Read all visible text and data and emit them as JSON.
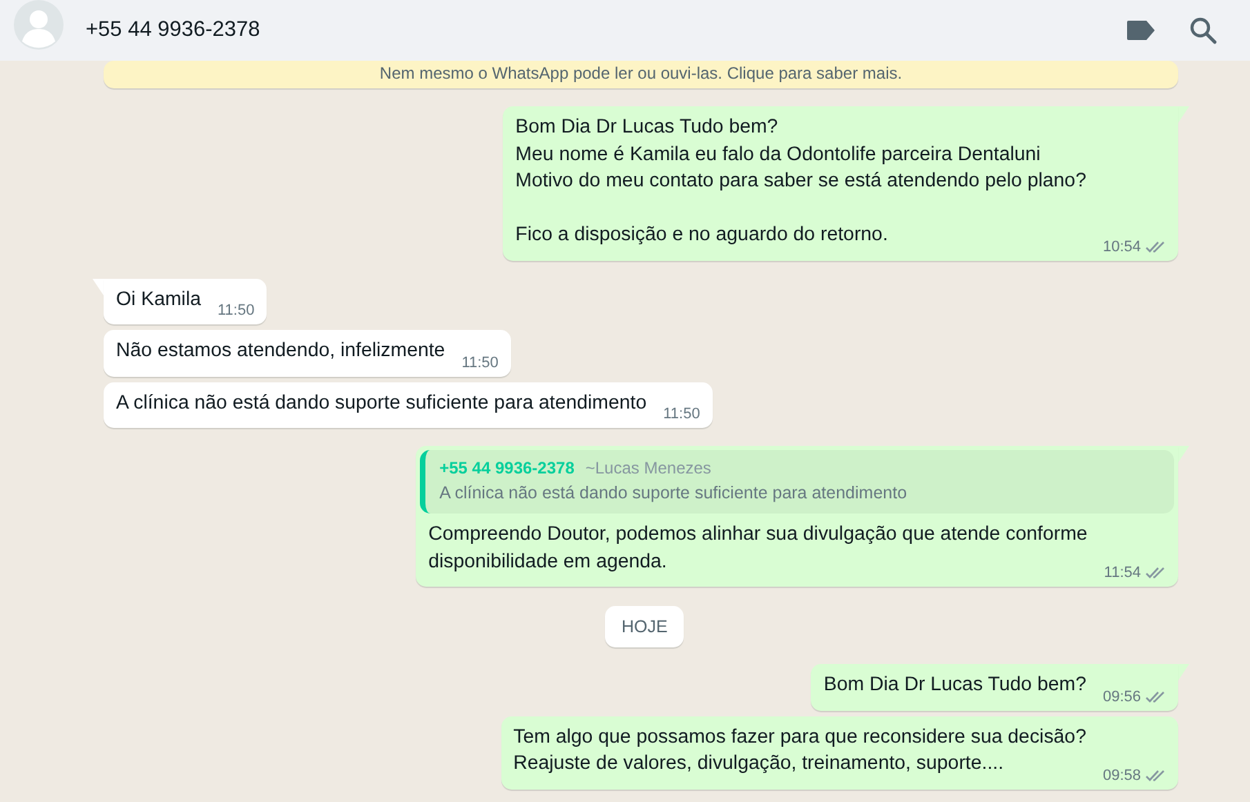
{
  "header": {
    "contact": "+55 44 9936-2378"
  },
  "encryption_notice": "Nem mesmo o WhatsApp pode ler ou ouvi-las. Clique para saber mais.",
  "items": [
    {
      "kind": "message",
      "outgoing": true,
      "tail": true,
      "text": "Bom Dia Dr Lucas Tudo bem?\nMeu nome é Kamila eu falo da Odontolife parceira Dentaluni\nMotivo do meu contato para saber se está atendendo pelo plano?\n\nFico a disposição e no aguardo do retorno.",
      "time": "10:54",
      "read": false
    },
    {
      "kind": "message",
      "outgoing": false,
      "tail": true,
      "text": "Oi Kamila",
      "time": "11:50"
    },
    {
      "kind": "message",
      "outgoing": false,
      "tail": false,
      "text": "Não estamos atendendo, infelizmente",
      "time": "11:50"
    },
    {
      "kind": "message",
      "outgoing": false,
      "tail": false,
      "text": "A clínica não está dando suporte suficiente para atendimento",
      "time": "11:50"
    },
    {
      "kind": "message",
      "outgoing": true,
      "tail": true,
      "quote": {
        "sender": "+55 44 9936-2378",
        "author": "~Lucas Menezes",
        "text": "A clínica não está dando suporte suficiente para atendimento"
      },
      "text": "Compreendo Doutor, podemos alinhar sua divulgação que atende conforme\ndisponibilidade em agenda.",
      "time": "11:54",
      "read": false
    },
    {
      "kind": "date",
      "text": "HOJE"
    },
    {
      "kind": "message",
      "outgoing": true,
      "tail": true,
      "text": "Bom Dia Dr Lucas Tudo bem?",
      "time": "09:56",
      "read": false
    },
    {
      "kind": "message",
      "outgoing": true,
      "tail": false,
      "text": "Tem algo que possamos fazer para que reconsidere sua decisão?\nReajuste de valores, divulgação, treinamento, suporte....",
      "time": "09:58",
      "read": false
    }
  ]
}
